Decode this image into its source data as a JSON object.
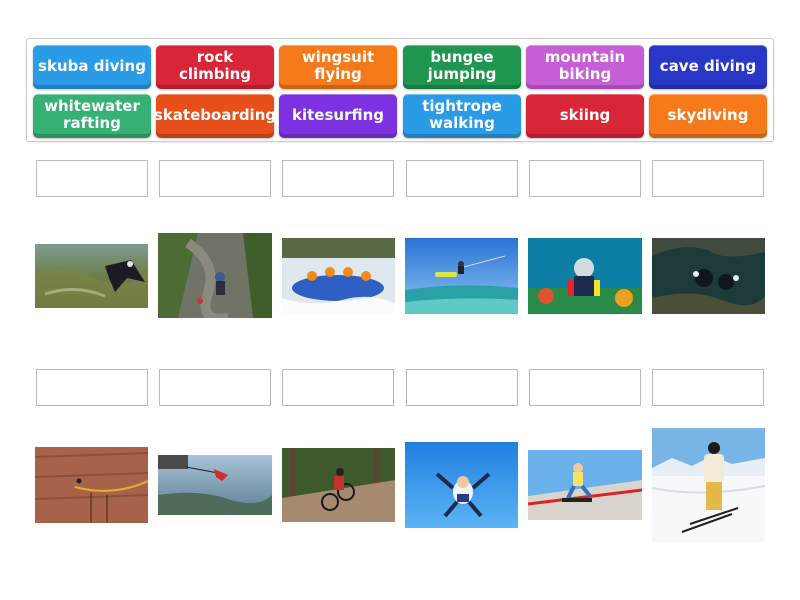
{
  "tiles": [
    {
      "label": "skuba diving",
      "color": "#2a9be6"
    },
    {
      "label": "rock climbing",
      "color": "#d92538"
    },
    {
      "label": "wingsuit flying",
      "color": "#f77a1a"
    },
    {
      "label": "bungee jumping",
      "color": "#1f9550"
    },
    {
      "label": "mountain biking",
      "color": "#c65fd6"
    },
    {
      "label": "cave diving",
      "color": "#2937c7"
    },
    {
      "label": "whitewater rafting",
      "color": "#36b074"
    },
    {
      "label": "skateboarding",
      "color": "#e8501b"
    },
    {
      "label": "kitesurfing",
      "color": "#7c32e0"
    },
    {
      "label": "tightrope walking",
      "color": "#2a9be6"
    },
    {
      "label": "skiing",
      "color": "#d92538"
    },
    {
      "label": "skydiving",
      "color": "#f77a1a"
    }
  ],
  "images": [
    "wingsuit-flying-photo",
    "rock-climbing-photo",
    "whitewater-rafting-photo",
    "kitesurfing-photo",
    "scuba-diving-photo",
    "cave-diving-photo",
    "tightrope-walking-photo",
    "bungee-jumping-photo",
    "mountain-biking-photo",
    "skydiving-photo",
    "skateboarding-photo",
    "skiing-photo"
  ]
}
